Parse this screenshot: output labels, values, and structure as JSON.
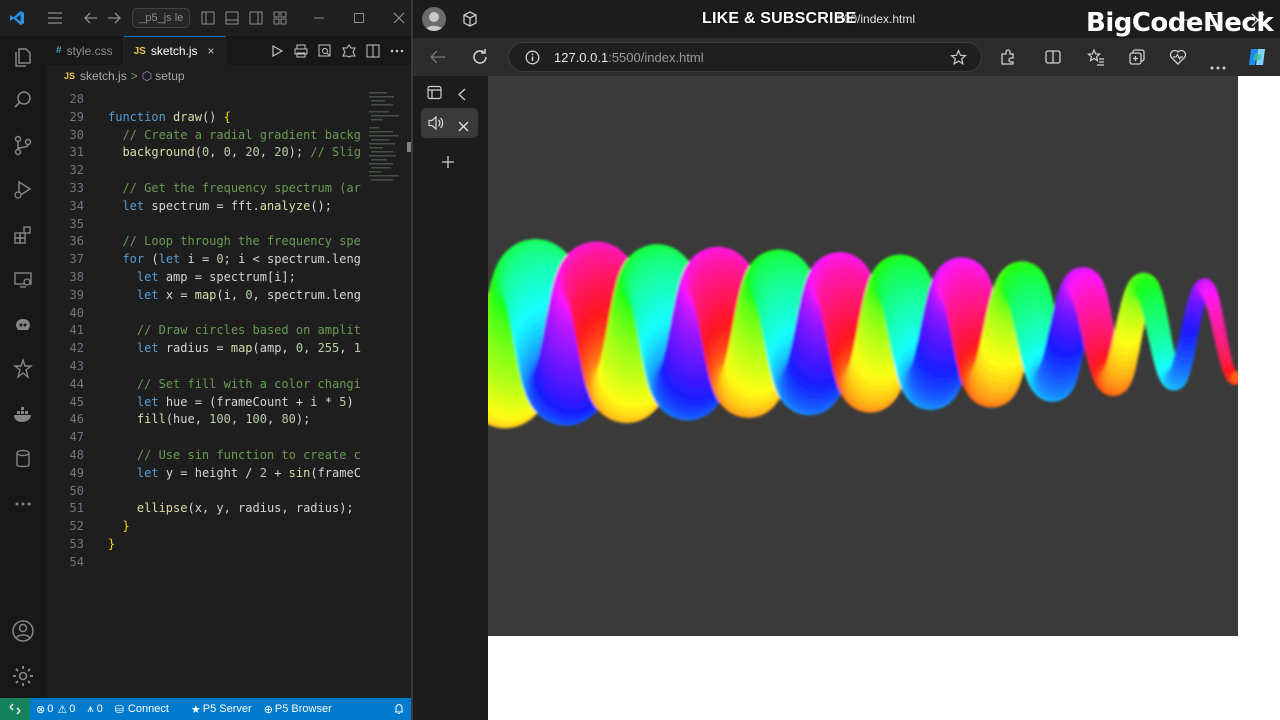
{
  "overlay": {
    "title": "LIKE & SUBSCRIBE",
    "brand": "BigCodeNeck"
  },
  "vscode": {
    "title_search": "_p5_js le",
    "tabs": [
      {
        "icon": "#",
        "label": "style.css",
        "active": false
      },
      {
        "icon": "JS",
        "label": "sketch.js",
        "active": true
      }
    ],
    "breadcrumb": {
      "file_icon": "JS",
      "file": "sketch.js",
      "separator": ">",
      "symbol": "setup"
    },
    "code_lines": [
      {
        "n": "28",
        "text": ""
      },
      {
        "n": "29",
        "text": "function draw() {"
      },
      {
        "n": "30",
        "text": "  // Create a radial gradient backg"
      },
      {
        "n": "31",
        "text": "  background(0, 0, 20, 20); // Slig"
      },
      {
        "n": "32",
        "text": ""
      },
      {
        "n": "33",
        "text": "  // Get the frequency spectrum (ar"
      },
      {
        "n": "34",
        "text": "  let spectrum = fft.analyze();"
      },
      {
        "n": "35",
        "text": ""
      },
      {
        "n": "36",
        "text": "  // Loop through the frequency spe"
      },
      {
        "n": "37",
        "text": "  for (let i = 0; i < spectrum.leng"
      },
      {
        "n": "38",
        "text": "    let amp = spectrum[i];"
      },
      {
        "n": "39",
        "text": "    let x = map(i, 0, spectrum.leng"
      },
      {
        "n": "40",
        "text": ""
      },
      {
        "n": "41",
        "text": "    // Draw circles based on amplit"
      },
      {
        "n": "42",
        "text": "    let radius = map(amp, 0, 255, 1"
      },
      {
        "n": "43",
        "text": ""
      },
      {
        "n": "44",
        "text": "    // Set fill with a color changi"
      },
      {
        "n": "45",
        "text": "    let hue = (frameCount + i * 5)"
      },
      {
        "n": "46",
        "text": "    fill(hue, 100, 100, 80);"
      },
      {
        "n": "47",
        "text": ""
      },
      {
        "n": "48",
        "text": "    // Use sin function to create c"
      },
      {
        "n": "49",
        "text": "    let y = height / 2 + sin(frameC"
      },
      {
        "n": "50",
        "text": ""
      },
      {
        "n": "51",
        "text": "    ellipse(x, y, radius, radius);"
      },
      {
        "n": "52",
        "text": "  }"
      },
      {
        "n": "53",
        "text": "}"
      },
      {
        "n": "54",
        "text": ""
      }
    ],
    "status": {
      "errors": "0",
      "warnings": "0",
      "ports": "0",
      "connect": "Connect",
      "p5_server": "P5 Server",
      "p5_browser": "P5 Browser"
    }
  },
  "browser": {
    "url_host": "127.0.0.1",
    "url_path": ":5500/index.html",
    "tab_title_fragment": "500/index.html"
  },
  "colors": {
    "vscode_bg": "#1e1e1e",
    "statusbar": "#007acc",
    "canvas_bg": "#3a3a3a",
    "page_bg": "#ffffff"
  }
}
